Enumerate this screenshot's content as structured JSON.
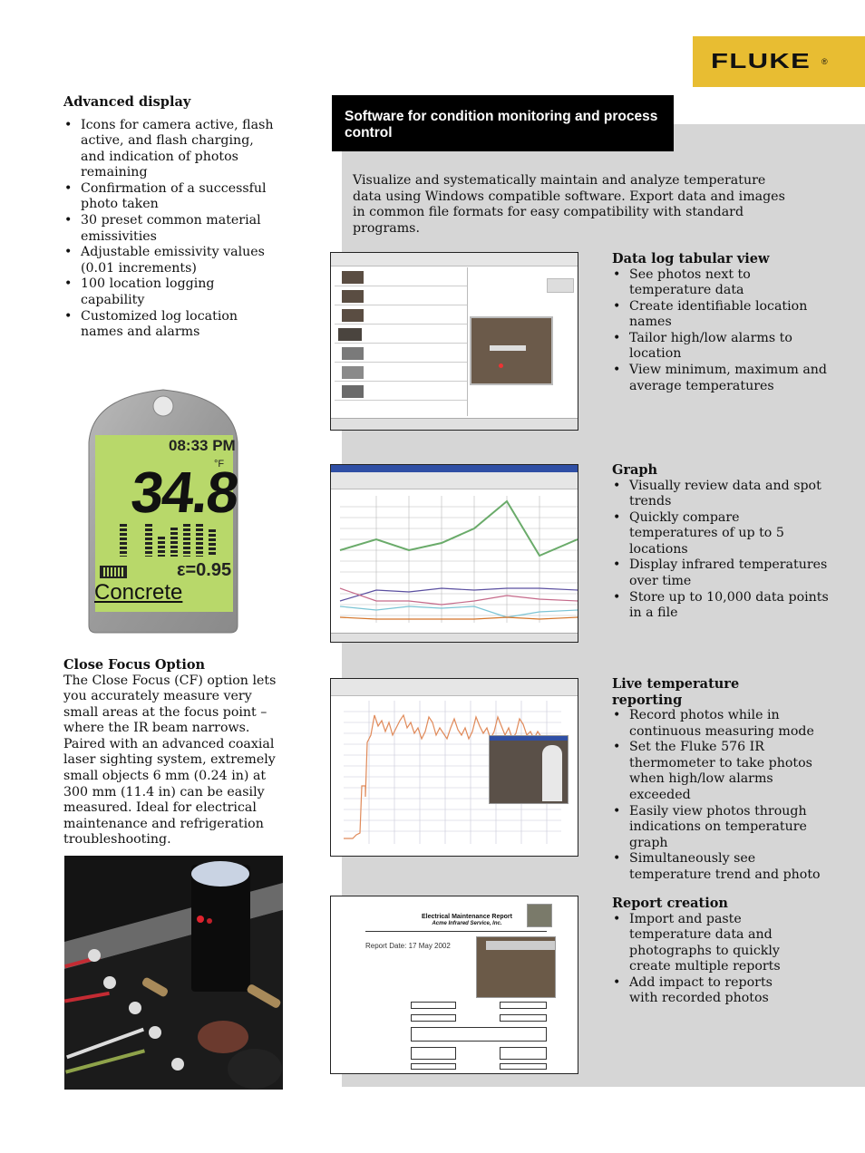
{
  "brand": {
    "name": "FLUKE",
    "registered_mark": "®"
  },
  "colors": {
    "brand_yellow": "#e8bd32",
    "panel_grey": "#d6d6d6",
    "heading_black": "#000000",
    "lcd_green": "#b8d86a"
  },
  "advanced_display": {
    "title": "Advanced display",
    "bullets": [
      "Icons for camera active, flash active, and flash charging, and indication of photos remaining",
      "Confirmation of a successful photo taken",
      "30 preset common material emissivities",
      "Adjustable emissivity values (0.01 increments)",
      "100 location logging capability",
      "Customized log location names and alarms"
    ]
  },
  "lcd": {
    "time": "08:33 PM",
    "unit": "°F",
    "reading": "34.8",
    "emissivity": "ε=0.95",
    "material": "Concrete"
  },
  "close_focus": {
    "title": "Close Focus Option",
    "body": "The Close Focus (CF) option lets you accurately measure very small areas at the focus point – where the IR beam narrows. Paired with an advanced coaxial laser sighting system, extremely small objects 6 mm (0.24 in) at 300 mm (11.4 in) can be easily measured. Ideal for electrical maintenance and refrigeration troubleshooting."
  },
  "software": {
    "heading": "Software for condition monitoring and process control",
    "intro": "Visualize and systematically maintain and analyze temperature data using Windows compatible software. Export data and images in common file formats for easy compatibility with standard programs.",
    "sections": [
      {
        "title": "Data log tabular view",
        "bullets": [
          "See photos next to temperature data",
          "Create identifiable location names",
          "Tailor high/low alarms to location",
          "View minimum, maximum and average temperatures"
        ]
      },
      {
        "title": "Graph",
        "bullets": [
          "Visually review data and spot trends",
          "Quickly compare temperatures of up to 5 locations",
          "Display infrared temperatures over time",
          "Store up to 10,000 data points in a file"
        ]
      },
      {
        "title": "Live temperature reporting",
        "bullets": [
          "Record photos while in continuous measuring mode",
          "Set the Fluke 576 IR thermometer to take photos when high/low alarms exceeded",
          "Easily view photos through indications on temperature graph",
          "Simultaneously see temperature trend and photo"
        ]
      },
      {
        "title": "Report creation",
        "bullets": [
          "Import and paste temperature data and photographs to quickly create multiple reports",
          "Add impact to reports with recorded photos"
        ]
      }
    ]
  },
  "report_shot": {
    "title": "Electrical Maintenance Report",
    "subtitle": "Acme Infrared Service, Inc.",
    "date": "Report Date: 17 May 2002"
  }
}
